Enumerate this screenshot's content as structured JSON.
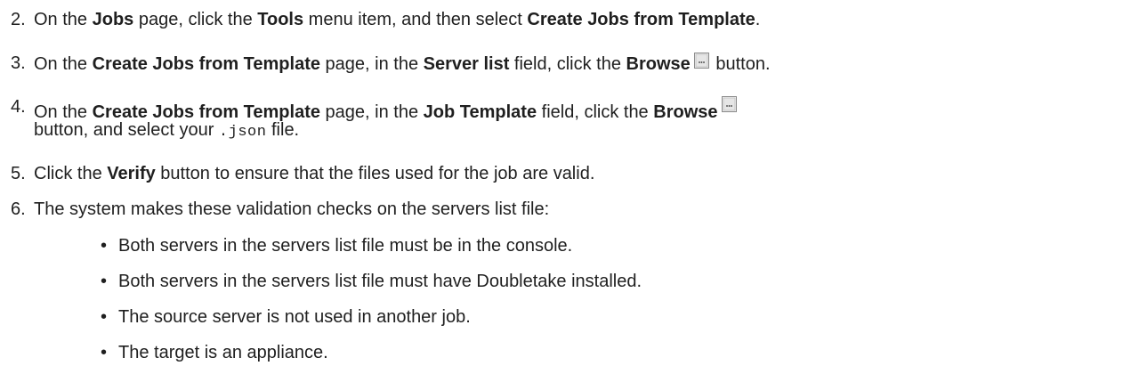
{
  "steps": [
    {
      "number": "2.",
      "parts": {
        "a": "On the ",
        "b": "Jobs",
        "c": " page, click the ",
        "d": "Tools",
        "e": " menu item, and then select ",
        "f": "Create Jobs from Template",
        "g": "."
      }
    },
    {
      "number": "3.",
      "parts": {
        "a": "On the ",
        "b": "Create Jobs from Template",
        "c": " page, in the ",
        "d": "Server list",
        "e": " field, click the ",
        "f": "Browse",
        "g": " button."
      }
    },
    {
      "number": "4.",
      "parts": {
        "a": "On the ",
        "b": "Create Jobs from Template",
        "c": " page, in the ",
        "d": "Job Template",
        "e": " field, click the ",
        "f": "Browse"
      },
      "line2": {
        "a": "button, and select your ",
        "code": ".json",
        "b": " file."
      }
    },
    {
      "number": "5.",
      "parts": {
        "a": "Click the ",
        "b": "Verify",
        "c": " button to ensure that the files used for the job are valid."
      }
    },
    {
      "number": "6.",
      "parts": {
        "a": "The system makes these validation checks on the servers list file:"
      }
    }
  ],
  "bullets": [
    "Both servers in the servers list file must be in the console.",
    "Both servers in the servers list file must have Doubletake installed.",
    "The source server is not used in another job.",
    "The target is an appliance."
  ],
  "bullet_char": "•",
  "icons": {
    "browse": "browse-button-icon"
  }
}
